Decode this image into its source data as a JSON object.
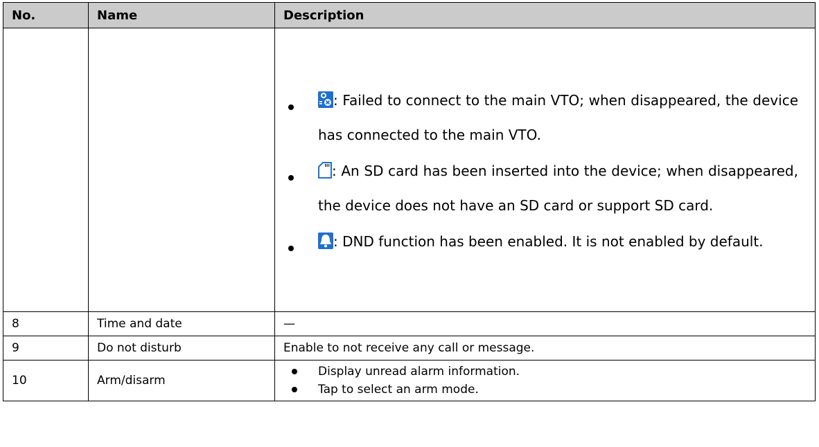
{
  "header": {
    "col_no": "No.",
    "col_name": "Name",
    "col_description": "Description"
  },
  "row_icons": {
    "items": [
      {
        "icon": "vto-disconnected-icon",
        "text": ": Failed to connect to the main VTO; when disappeared, the device has connected to the main VTO."
      },
      {
        "icon": "sd-card-icon",
        "text": ": An SD card has been inserted into the device; when disappeared, the device does not have an SD card or support SD card."
      },
      {
        "icon": "dnd-bell-icon",
        "text": ": DND function has been enabled. It is not enabled by default."
      }
    ]
  },
  "rows": [
    {
      "no": "8",
      "name": "Time and date",
      "description": "—"
    },
    {
      "no": "9",
      "name": "Do not disturb",
      "description": "Enable to not receive any call or message."
    },
    {
      "no": "10",
      "name": "Arm/disarm",
      "bullets": [
        "Display unread alarm information.",
        "Tap to select an arm mode."
      ]
    }
  ],
  "colors": {
    "header_bg": "#cbcbcb",
    "icon_blue": "#1f6fd1"
  }
}
